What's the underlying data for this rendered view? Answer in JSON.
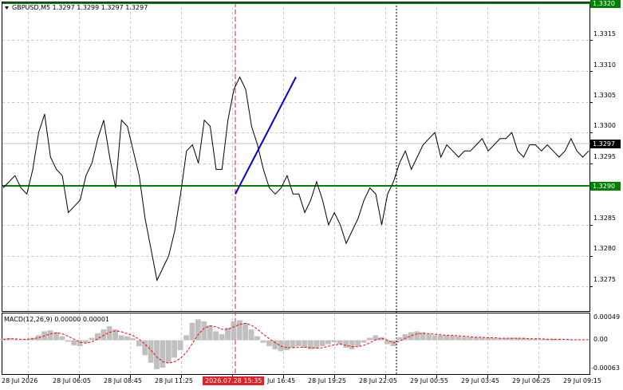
{
  "chart": {
    "symbol_line": "GBPUSD,M5  1.3297 1.3299 1.3297 1.3297",
    "macd_label": "MACD(12,26,9) 0.00000 0.00001",
    "price_labels": [
      "1.3315",
      "1.3310",
      "1.3305",
      "1.3300",
      "1.3295",
      "1.3285",
      "1.3280",
      "1.3275"
    ],
    "price_tags": {
      "top": "1.3320",
      "current": "1.3297",
      "level": "1.3290"
    },
    "macd_labels": [
      "0.00049",
      "0.00",
      "-0.00063"
    ],
    "time_labels": [
      "28 Jul 2026",
      "28 Jul 06:05",
      "28 Jul 08:45",
      "28 Jul 11:25",
      "2026.07.28 15:35",
      "Jul 16:45",
      "28 Jul 19:25",
      "28 Jul 22:05",
      "29 Jul 00:55",
      "29 Jul 03:45",
      "29 Jul 06:25",
      "29 Jul 09:15"
    ],
    "colors": {
      "level_line": "#008000",
      "trend_line": "#0000cc",
      "price_line": "#000000",
      "macd_hist": "#c0c0c0",
      "macd_signal": "#ff0000",
      "time_marker": "#e0202a"
    }
  },
  "chart_data": {
    "type": "line",
    "title": "GBPUSD,M5",
    "ylim": [
      1.3271,
      1.3321
    ],
    "levels": [
      1.332,
      1.329
    ],
    "trendline": {
      "from": 1.329,
      "to": 1.3309
    },
    "x": [
      0,
      1,
      2,
      3,
      4,
      5,
      6,
      7,
      8,
      9,
      10,
      11,
      12,
      13,
      14,
      15,
      16,
      17,
      18,
      19,
      20,
      21,
      22,
      23,
      24,
      25,
      26,
      27,
      28,
      29,
      30,
      31,
      32,
      33,
      34,
      35,
      36,
      37,
      38,
      39,
      40,
      41,
      42,
      43,
      44,
      45,
      46,
      47,
      48,
      49,
      50,
      51,
      52,
      53,
      54,
      55,
      56,
      57,
      58,
      59,
      60,
      61,
      62,
      63,
      64,
      65,
      66,
      67,
      68,
      69,
      70,
      71,
      72,
      73,
      74,
      75,
      76,
      77,
      78,
      79,
      80,
      81,
      82,
      83,
      84,
      85,
      86,
      87,
      88,
      89,
      90,
      91,
      92,
      93,
      94,
      95,
      96,
      97,
      98,
      99
    ],
    "values": [
      1.3291,
      1.3292,
      1.3293,
      1.3291,
      1.329,
      1.3294,
      1.33,
      1.3303,
      1.3296,
      1.3294,
      1.3293,
      1.3287,
      1.3288,
      1.3289,
      1.3293,
      1.3295,
      1.3299,
      1.3302,
      1.3296,
      1.3291,
      1.3302,
      1.3301,
      1.3297,
      1.3293,
      1.3286,
      1.3281,
      1.3276,
      1.3278,
      1.328,
      1.3284,
      1.329,
      1.3297,
      1.3298,
      1.3295,
      1.3302,
      1.3301,
      1.3294,
      1.3294,
      1.3302,
      1.3307,
      1.3309,
      1.3307,
      1.3301,
      1.3298,
      1.3294,
      1.3291,
      1.329,
      1.3291,
      1.3293,
      1.329,
      1.329,
      1.3287,
      1.3289,
      1.3292,
      1.3289,
      1.3285,
      1.3287,
      1.3285,
      1.3282,
      1.3284,
      1.3286,
      1.3289,
      1.3291,
      1.329,
      1.3285,
      1.329,
      1.3292,
      1.3295,
      1.3297,
      1.3294,
      1.3296,
      1.3298,
      1.3299,
      1.33,
      1.3296,
      1.3298,
      1.3297,
      1.3296,
      1.3297,
      1.3297,
      1.3298,
      1.3299,
      1.3297,
      1.3298,
      1.3299,
      1.3299,
      1.33,
      1.3297,
      1.3296,
      1.3298,
      1.3298,
      1.3297,
      1.3298,
      1.3297,
      1.3296,
      1.3297,
      1.3299,
      1.3297,
      1.3296,
      1.3297
    ],
    "macd": {
      "ylim": [
        -0.00063,
        0.00049
      ],
      "histogram": [
        3e-05,
        4e-05,
        2e-05,
        1e-05,
        2e-05,
        5e-05,
        0.0001,
        0.00018,
        0.0002,
        0.00016,
        8e-05,
        -3e-05,
        -0.0001,
        -0.00012,
        -5e-05,
        5e-05,
        0.00014,
        0.00022,
        0.00028,
        0.00022,
        0.0001,
        8e-05,
        4e-05,
        -0.00012,
        -0.0003,
        -0.00045,
        -0.00058,
        -0.00055,
        -0.00045,
        -0.00035,
        -0.0002,
        0.0001,
        0.00035,
        0.00042,
        0.00038,
        0.0003,
        0.00018,
        0.00012,
        0.00025,
        0.00038,
        0.0004,
        0.00035,
        0.00022,
        8e-05,
        -5e-05,
        -0.00012,
        -0.00018,
        -0.00022,
        -0.0002,
        -0.00015,
        -0.00012,
        -0.00015,
        -0.00018,
        -0.00016,
        -0.00012,
        -8e-05,
        -4e-05,
        -8e-05,
        -0.00015,
        -0.00018,
        -0.00012,
        -5e-05,
        5e-05,
        0.0001,
        6e-05,
        -8e-05,
        -0.00012,
        6e-05,
        0.00012,
        0.00016,
        0.00018,
        0.00016,
        0.00012,
        0.0001,
        0.0001,
        0.0001,
        9e-05,
        8e-05,
        7e-05,
        6e-05,
        6e-05,
        5e-05,
        5e-05,
        4e-05,
        4e-05,
        4e-05,
        5e-05,
        5e-05,
        4e-05,
        3e-05,
        3e-05,
        2e-05,
        2e-05,
        3e-05,
        2e-05,
        1e-05,
        1e-05,
        1e-05,
        0.0,
        0.0
      ],
      "signal": [
        2e-05,
        3e-05,
        3e-05,
        2e-05,
        2e-05,
        3e-05,
        5e-05,
        9e-05,
        0.00013,
        0.00015,
        0.00013,
        8e-05,
        2e-05,
        -4e-05,
        -6e-05,
        -3e-05,
        3e-05,
        0.0001,
        0.00016,
        0.00019,
        0.00017,
        0.00013,
        9e-05,
        2e-05,
        -8e-05,
        -0.0002,
        -0.00034,
        -0.00043,
        -0.00046,
        -0.00043,
        -0.00036,
        -0.00024,
        -6e-05,
        0.00012,
        0.00024,
        0.00029,
        0.00027,
        0.00022,
        0.00022,
        0.00027,
        0.00032,
        0.00034,
        0.0003,
        0.00022,
        0.00012,
        3e-05,
        -5e-05,
        -0.00012,
        -0.00015,
        -0.00015,
        -0.00014,
        -0.00014,
        -0.00015,
        -0.00016,
        -0.00015,
        -0.00012,
        -9e-05,
        -8e-05,
        -0.0001,
        -0.00013,
        -0.00013,
        -0.0001,
        -5e-05,
        1e-05,
        4e-05,
        0.0,
        -5e-05,
        -2e-05,
        4e-05,
        9e-05,
        0.00013,
        0.00014,
        0.00013,
        0.00012,
        0.00011,
        0.0001,
        0.0001,
        9e-05,
        8e-05,
        7e-05,
        6e-05,
        6e-05,
        5e-05,
        5e-05,
        4e-05,
        4e-05,
        4e-05,
        4e-05,
        4e-05,
        3e-05,
        3e-05,
        3e-05,
        2e-05,
        2e-05,
        2e-05,
        2e-05,
        1e-05,
        1e-05,
        1e-05,
        1e-05
      ]
    }
  }
}
